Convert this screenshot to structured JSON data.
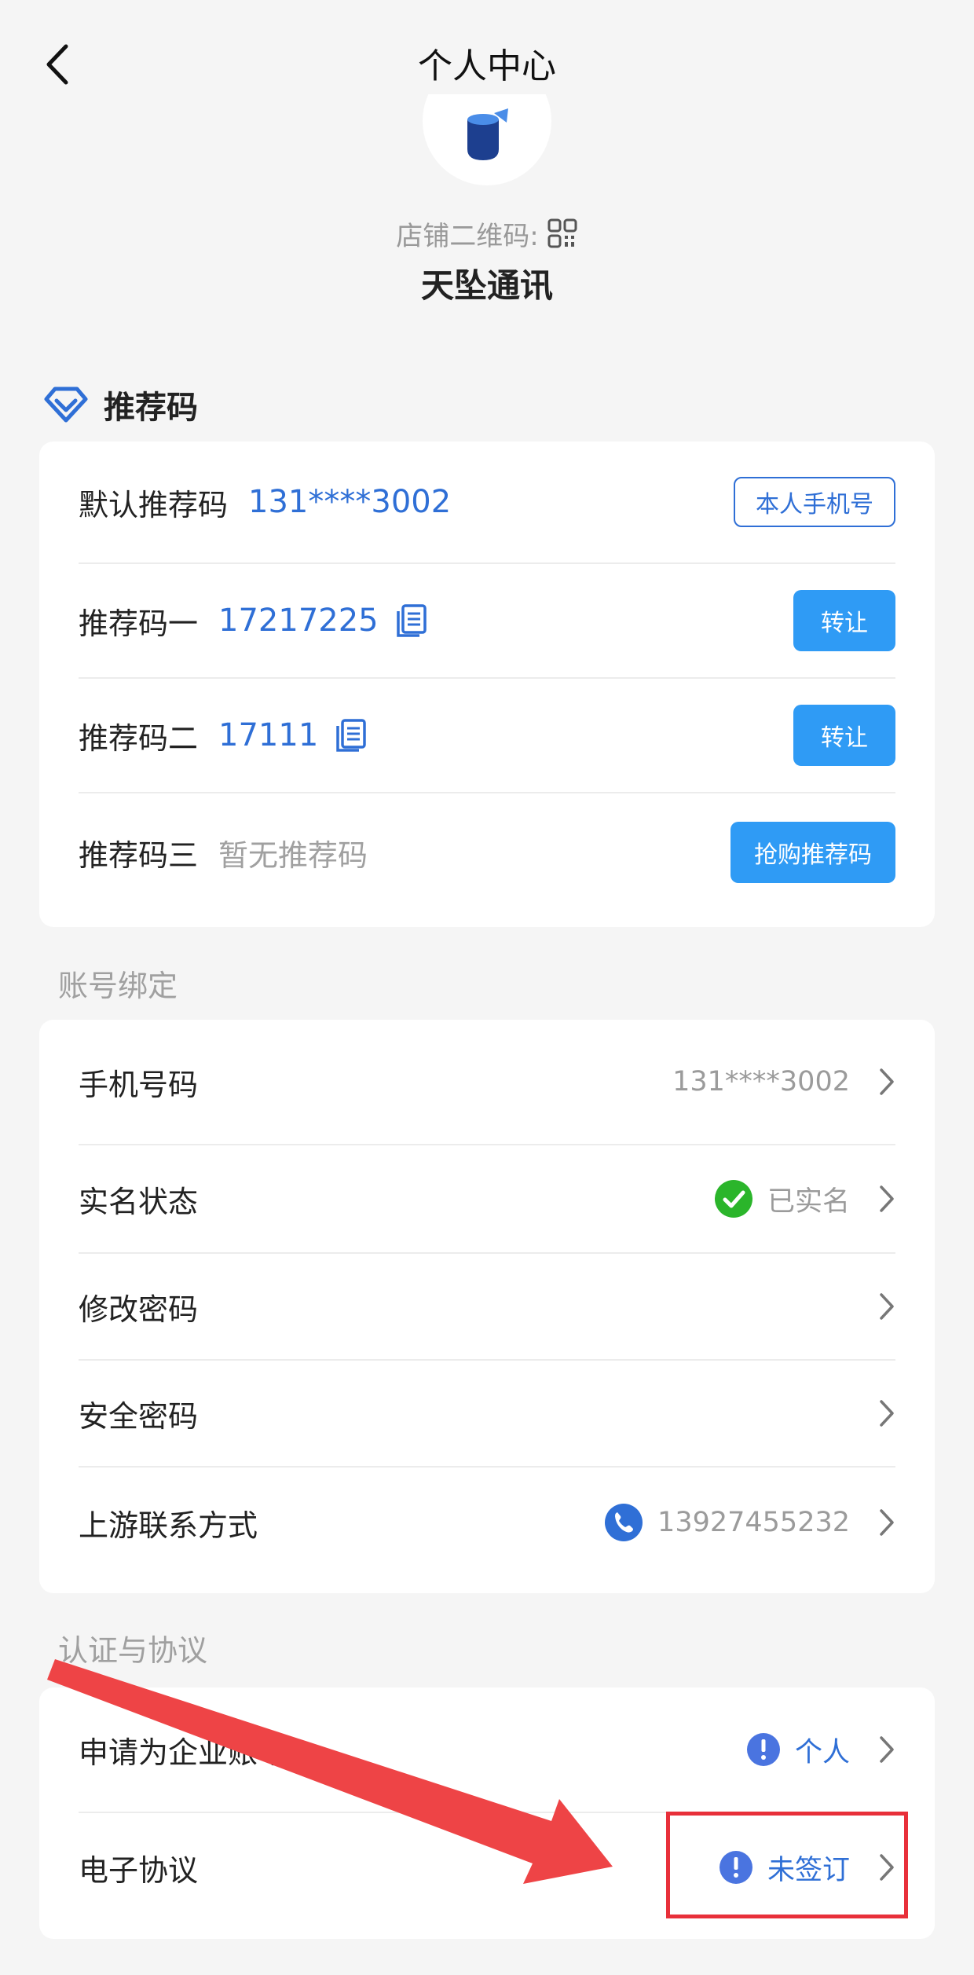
{
  "header": {
    "title": "个人中心",
    "back_icon": "chevron-left-icon"
  },
  "profile": {
    "qr_label": "店铺二维码:",
    "qr_icon": "qr-code-icon",
    "shop_name": "天坠通讯"
  },
  "referral": {
    "section_title": "推荐码",
    "section_icon": "diamond-icon",
    "rows": [
      {
        "label": "默认推荐码",
        "value": "131****3002",
        "button": "本人手机号"
      },
      {
        "label": "推荐码一",
        "value": "17217225",
        "button": "转让"
      },
      {
        "label": "推荐码二",
        "value": "17111",
        "button": "转让"
      },
      {
        "label": "推荐码三",
        "value": "暂无推荐码",
        "button": "抢购推荐码"
      }
    ]
  },
  "account": {
    "group_title": "账号绑定",
    "rows": [
      {
        "label": "手机号码",
        "value": "131****3002"
      },
      {
        "label": "实名状态",
        "value": "已实名",
        "icon": "verified-check-icon"
      },
      {
        "label": "修改密码",
        "value": ""
      },
      {
        "label": "安全密码",
        "value": ""
      },
      {
        "label": "上游联系方式",
        "value": "13927455232",
        "icon": "phone-icon"
      }
    ]
  },
  "certification": {
    "group_title": "认证与协议",
    "rows": [
      {
        "label": "申请为企业账号",
        "value": "个人",
        "icon": "exclamation-icon"
      },
      {
        "label": "电子协议",
        "value": "未签订",
        "icon": "exclamation-icon"
      }
    ]
  },
  "colors": {
    "accent_blue": "#2f6fd6",
    "button_blue": "#2f9bf5",
    "verified_green": "#2bb52b",
    "annotation_red": "#e8303a",
    "background": "#f5f5f5"
  }
}
